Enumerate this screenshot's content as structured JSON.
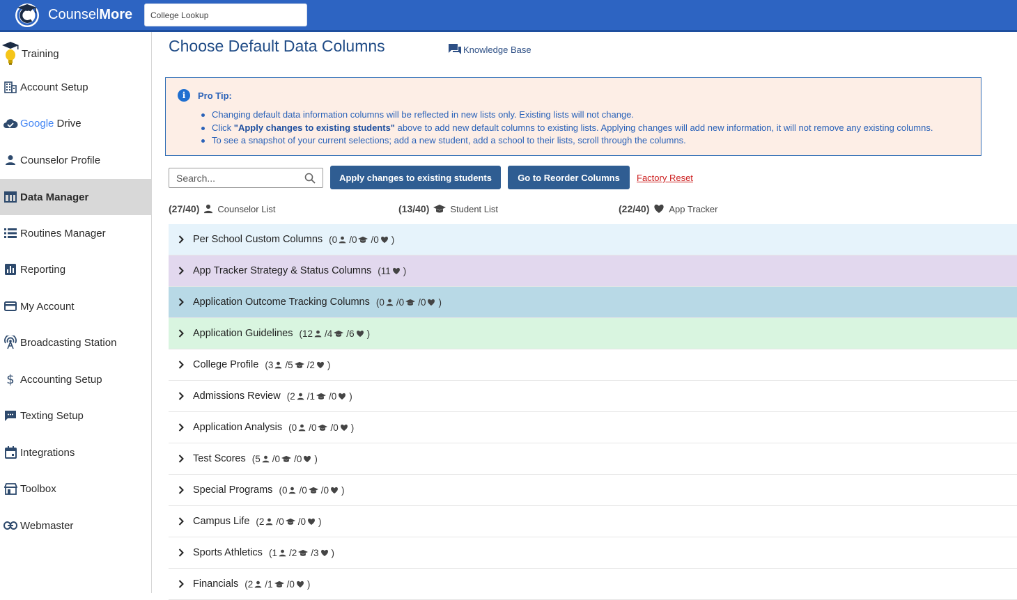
{
  "header": {
    "brand_light": "Counsel",
    "brand_bold": "More",
    "lookup_placeholder": "College Lookup"
  },
  "sidebar": {
    "items": [
      {
        "label": "Training",
        "icon": "graduation-bulb-icon"
      },
      {
        "label": "Account Setup",
        "icon": "building-icon"
      },
      {
        "label": "Drive",
        "prefix": "Google",
        "icon": "cloud-check-icon"
      },
      {
        "label": "Counselor Profile",
        "icon": "person-icon"
      },
      {
        "label": "Data Manager",
        "icon": "table-icon",
        "active": true
      },
      {
        "label": "Routines Manager",
        "icon": "list-icon"
      },
      {
        "label": "Reporting",
        "icon": "bar-chart-icon"
      },
      {
        "label": "My Account",
        "icon": "card-icon"
      },
      {
        "label": "Broadcasting Station",
        "icon": "antenna-icon"
      },
      {
        "label": "Accounting Setup",
        "icon": "dollar-icon"
      },
      {
        "label": "Texting Setup",
        "icon": "chat-icon"
      },
      {
        "label": "Integrations",
        "icon": "calendar-icon"
      },
      {
        "label": "Toolbox",
        "icon": "store-icon"
      },
      {
        "label": "Webmaster",
        "icon": "link-icon"
      }
    ]
  },
  "main": {
    "title": "Choose Default Data Columns",
    "kb_label": "Knowledge Base",
    "protip": {
      "title": "Pro Tip:",
      "line1": "Changing default data information columns will be reflected in new lists only. Existing lists will not change.",
      "line2_pre": "Click ",
      "line2_bold": "\"Apply changes to existing students\"",
      "line2_post": " above to add new default columns to existing lists. Applying changes will add new information, it will not remove any existing columns.",
      "line3": "To see a snapshot of your current selections; add a new student, add a school to their lists, scroll through the columns."
    },
    "search_placeholder": "Search...",
    "apply_label": "Apply changes to existing students",
    "reorder_label": "Go to Reorder Columns",
    "factory_label": "Factory Reset",
    "counts": [
      {
        "value": "(27/40)",
        "label": "Counselor List",
        "icon": "person-icon"
      },
      {
        "value": "(13/40)",
        "label": "Student List",
        "icon": "grad-cap-icon"
      },
      {
        "value": "(22/40)",
        "label": "App Tracker",
        "icon": "heart-icon"
      }
    ],
    "sections": [
      {
        "title": "Per School Custom Columns",
        "c": "0",
        "s": "0",
        "a": "0",
        "bg": "#e6f3fb"
      },
      {
        "title": "App Tracker Strategy & Status Columns",
        "a_only": "11",
        "bg": "#e2d8ee"
      },
      {
        "title": "Application Outcome Tracking Columns",
        "c": "0",
        "s": "0",
        "a": "0",
        "bg": "#b8d9e6"
      },
      {
        "title": "Application Guidelines",
        "c": "12",
        "s": "4",
        "a": "6",
        "bg": "#d9f5e0"
      },
      {
        "title": "College Profile",
        "c": "3",
        "s": "5",
        "a": "2",
        "bg": "#ffffff"
      },
      {
        "title": "Admissions Review",
        "c": "2",
        "s": "1",
        "a": "0",
        "bg": "#ffffff"
      },
      {
        "title": "Application Analysis",
        "c": "0",
        "s": "0",
        "a": "0",
        "bg": "#ffffff"
      },
      {
        "title": "Test Scores",
        "c": "5",
        "s": "0",
        "a": "0",
        "bg": "#ffffff"
      },
      {
        "title": "Special Programs",
        "c": "0",
        "s": "0",
        "a": "0",
        "bg": "#ffffff"
      },
      {
        "title": "Campus Life",
        "c": "2",
        "s": "0",
        "a": "0",
        "bg": "#ffffff"
      },
      {
        "title": "Sports Athletics",
        "c": "1",
        "s": "2",
        "a": "3",
        "bg": "#ffffff"
      },
      {
        "title": "Financials",
        "c": "2",
        "s": "1",
        "a": "0",
        "bg": "#ffffff"
      }
    ]
  }
}
